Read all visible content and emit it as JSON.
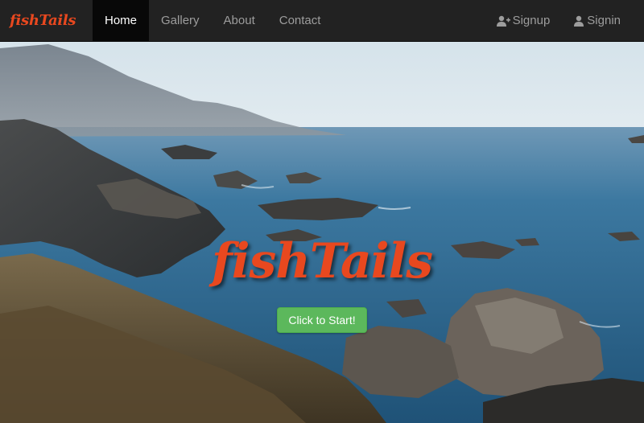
{
  "navbar": {
    "brand": "fishTails",
    "links": [
      {
        "label": "Home",
        "active": true
      },
      {
        "label": "Gallery",
        "active": false
      },
      {
        "label": "About",
        "active": false
      },
      {
        "label": "Contact",
        "active": false
      }
    ],
    "signup": {
      "label": "Signup",
      "icon": "user-plus-icon"
    },
    "signin": {
      "label": "Signin",
      "icon": "user-icon"
    }
  },
  "hero": {
    "title": "fishTails",
    "button_label": "Click to Start!"
  },
  "colors": {
    "brand": "#e8481f",
    "navbar_bg": "#222222",
    "button_green": "#5cb85c"
  }
}
